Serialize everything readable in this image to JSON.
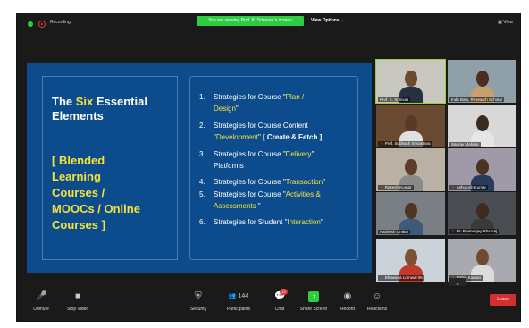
{
  "top_bar": {
    "recording_label": "Recording",
    "view_banner": "You are viewing Prof. K. Srinivas 's screen",
    "view_options": "View Options ⌄",
    "view_toggle": "▦ View"
  },
  "slide": {
    "title_prefix": "The ",
    "title_highlight": "Six",
    "title_suffix": " Essential",
    "title_line2": "Elements",
    "subtitle_lines": [
      "[ Blended",
      "Learning",
      "Courses /",
      "MOOCs / Online",
      "Courses ]"
    ],
    "items": [
      {
        "num": "1.",
        "pre": "Strategies for Course \"",
        "hl": "Plan /",
        "post": ""
      },
      {
        "num": "",
        "pre": "",
        "hl": "Design",
        "post": "\""
      },
      {
        "num": "2.",
        "pre": "Strategies for Course Content",
        "hl": "",
        "post": ""
      },
      {
        "num": "",
        "pre": "\"",
        "hl": "Development",
        "post": "\" ",
        "bold": "[ Create & Fetch ]"
      },
      {
        "num": "3.",
        "pre": "Strategies for  Course \"",
        "hl": "Delivery",
        "post": "\""
      },
      {
        "num": "",
        "pre": "Platforms",
        "hl": "",
        "post": ""
      },
      {
        "num": "4.",
        "pre": "Strategies for Course \"",
        "hl": "Transaction",
        "post": "\""
      },
      {
        "num": "5.",
        "pre": "Strategies for Course \"",
        "hl": "Activities &",
        "post": ""
      },
      {
        "num": "",
        "pre": "",
        "hl": "Assessments",
        "post": " \""
      },
      {
        "num": "6.",
        "pre": "Strategies for Student \"",
        "hl": "Interaction",
        "post": "\""
      }
    ]
  },
  "participants": [
    {
      "name": "Prof. K. Srinivas",
      "muted": false
    },
    {
      "name": "Indu Bala, Research Scholar",
      "muted": false
    },
    {
      "name": "Prof. Subhash Srivastava",
      "muted": true
    },
    {
      "name": "Saurav Mahato",
      "muted": false
    },
    {
      "name": "Rakesh Kumar",
      "muted": true
    },
    {
      "name": "Ashutosh Kumar",
      "muted": true
    },
    {
      "name": "Pathlesh Omkar",
      "muted": false
    },
    {
      "name": "Dr. Dhananjay Dheeraj",
      "muted": true
    },
    {
      "name": "Bhawana Lornwal 06",
      "muted": true
    },
    {
      "name": "Rabia Kumari",
      "muted": true
    }
  ],
  "toolbar": {
    "unmute": "Unmute",
    "stop_video": "Stop Video",
    "security": "Security",
    "participants": "Participants",
    "participants_count": "144",
    "chat": "Chat",
    "chat_badge": "12",
    "share_screen": "Share Screen",
    "record": "Record",
    "reactions": "Reactions",
    "leave": "Leave"
  },
  "colors": {
    "slide_bg": "#0d4c8c",
    "highlight": "#f5e33b",
    "banner": "#2ecc40",
    "leave": "#d32f2f"
  }
}
